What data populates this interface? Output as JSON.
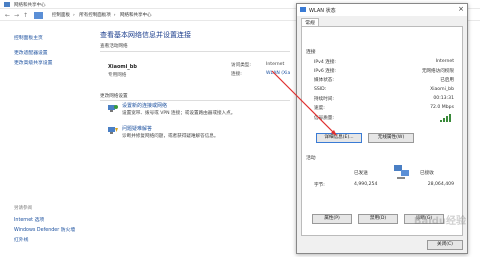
{
  "window": {
    "title": "网络和共享中心"
  },
  "address": {
    "crumbs": [
      "控制面板",
      "所有控制面板项",
      "网络和共享中心"
    ]
  },
  "sidebar": {
    "items": [
      "控制面板主页",
      "更改适配器设置",
      "更改高级共享设置"
    ],
    "see_also_header": "另请参阅",
    "see_also": [
      "Internet 选项",
      "Windows Defender 防火墙",
      "红外线"
    ]
  },
  "main": {
    "heading": "查看基本网络信息并设置连接",
    "active_networks_label": "查看活动网络",
    "network_name": "Xiaomi_bb",
    "network_type": "专用网络",
    "access_type_label": "访问类型:",
    "access_type_value": "Internet",
    "connections_label": "连接:",
    "connections_value": "WLAN (Xia",
    "change_settings_label": "更改网络设置",
    "tasks": [
      {
        "title": "设置新的连接或网络",
        "desc": "设置宽带、拨号或 VPN 连接；或设置路由器或接入点。"
      },
      {
        "title": "问题疑难解答",
        "desc": "诊断并修复网络问题，或者获得疑难解答信息。"
      }
    ]
  },
  "dialog": {
    "title": "WLAN 状态",
    "tab": "常规",
    "connection_group": "连接",
    "rows": [
      {
        "label": "IPv4 连接:",
        "value": "Internet"
      },
      {
        "label": "IPv6 连接:",
        "value": "无网络访问权限"
      },
      {
        "label": "媒体状态:",
        "value": "已启用"
      },
      {
        "label": "SSID:",
        "value": "Xiaomi_bb"
      },
      {
        "label": "持续时间:",
        "value": "00:13:31"
      },
      {
        "label": "速度:",
        "value": "72.0 Mbps"
      },
      {
        "label": "信号质量:",
        "value": ""
      }
    ],
    "details_button": "详细信息(E)...",
    "wireless_button": "无线属性(W)",
    "activity_group": "活动",
    "sent_label": "已发送",
    "received_label": "已接收",
    "bytes_label": "字节:",
    "bytes_sent": "4,990,254",
    "bytes_received": "28,064,409",
    "properties_button": "属性(P)",
    "disable_button": "禁用(D)",
    "diagnose_button": "诊断(G)",
    "close_button": "关闭(C)"
  },
  "watermark": "Baidu经验",
  "colors": {
    "link": "#1a4f9e",
    "heading": "#1a3c8c",
    "signal": "#3a8a3a",
    "arrow": "#e03030"
  }
}
